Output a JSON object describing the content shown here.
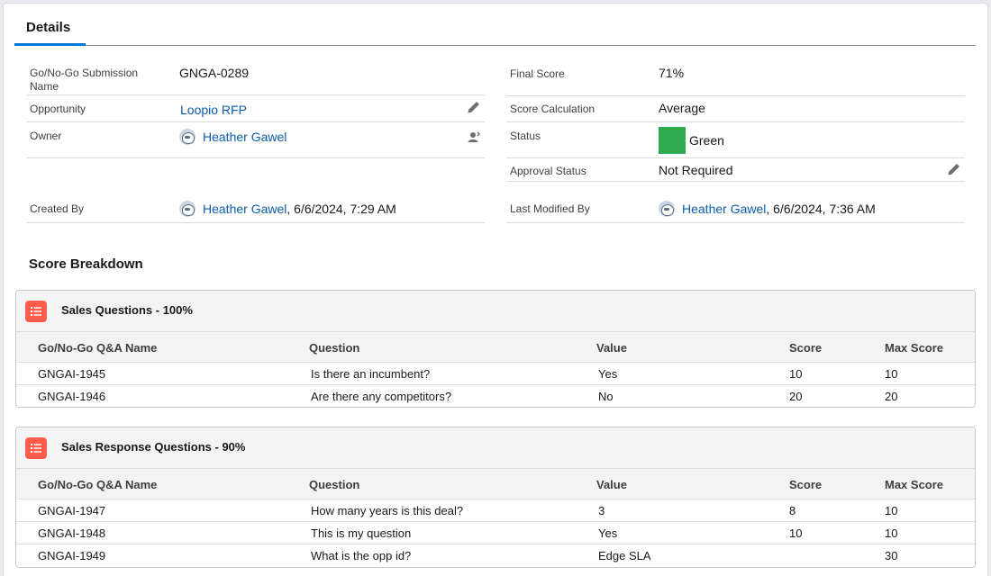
{
  "tab": {
    "label": "Details"
  },
  "fields": {
    "submission_name": {
      "label": "Go/No-Go Submission Name",
      "value": "GNGA-0289"
    },
    "final_score": {
      "label": "Final Score",
      "value": "71%"
    },
    "opportunity": {
      "label": "Opportunity",
      "value": "Loopio RFP"
    },
    "score_calculation": {
      "label": "Score Calculation",
      "value": "Average"
    },
    "owner": {
      "label": "Owner",
      "value": "Heather Gawel"
    },
    "status": {
      "label": "Status",
      "value": "Green",
      "color": "#2eaa4f"
    },
    "approval_status": {
      "label": "Approval Status",
      "value": "Not Required"
    },
    "created_by": {
      "label": "Created By",
      "user": "Heather Gawel",
      "date": ", 6/6/2024, 7:29 AM"
    },
    "last_modified_by": {
      "label": "Last Modified By",
      "user": "Heather Gawel",
      "date": ", 6/6/2024, 7:36 AM"
    }
  },
  "score_breakdown": {
    "title": "Score Breakdown",
    "columns": [
      "Go/No-Go Q&A Name",
      "Question",
      "Value",
      "Score",
      "Max Score"
    ],
    "sections": [
      {
        "title": "Sales Questions - 100%",
        "rows": [
          [
            "GNGAI-1945",
            "Is there an incumbent?",
            "Yes",
            "10",
            "10"
          ],
          [
            "GNGAI-1946",
            "Are there any competitors?",
            "No",
            "20",
            "20"
          ]
        ]
      },
      {
        "title": "Sales Response Questions - 90%",
        "rows": [
          [
            "GNGAI-1947",
            "How many years is this deal?",
            "3",
            "8",
            "10"
          ],
          [
            "GNGAI-1948",
            "This is my question",
            "Yes",
            "10",
            "10"
          ],
          [
            "GNGAI-1949",
            "What is the opp id?",
            "Edge SLA",
            "",
            "30"
          ]
        ]
      }
    ]
  },
  "icons": {
    "edit": "pencil-icon",
    "change_owner": "change-owner-icon",
    "related_list": "list-icon",
    "avatar": "user-avatar-icon"
  },
  "colors": {
    "accent": "#0176d3",
    "link": "#0b5cab",
    "related_icon": "#fe5c4c"
  }
}
